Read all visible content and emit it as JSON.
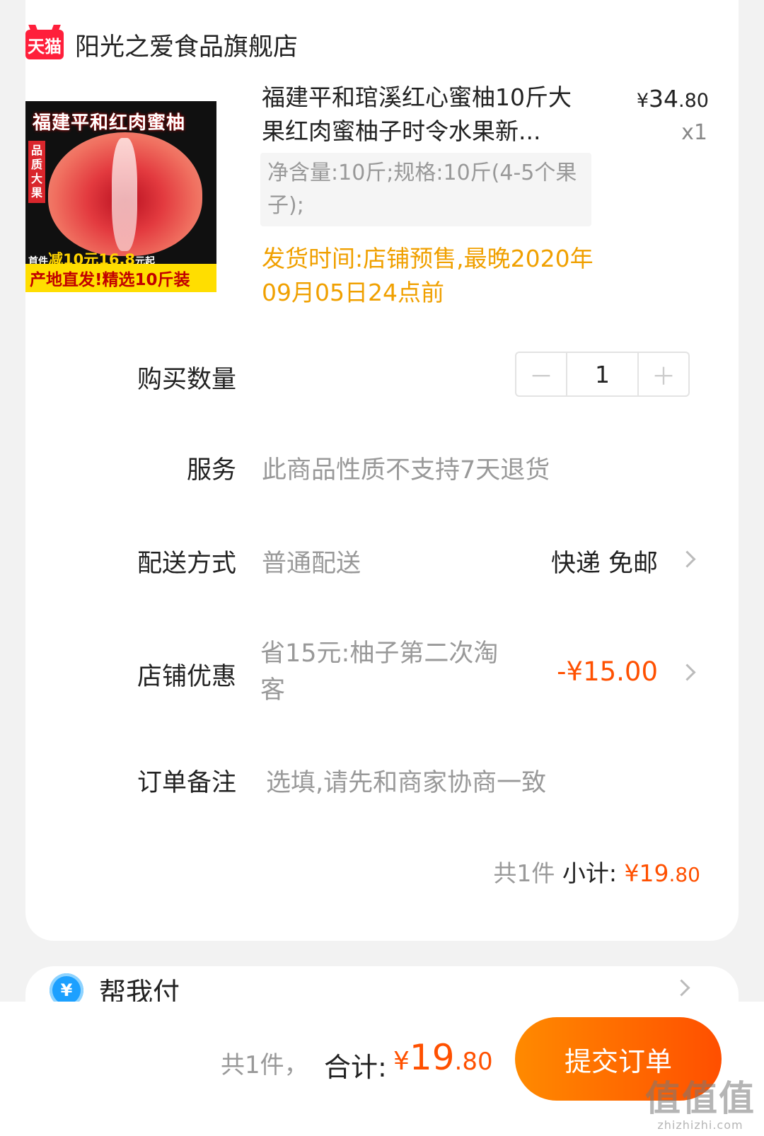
{
  "store": {
    "badge": "天猫",
    "name": "阳光之爱食品旗舰店"
  },
  "product": {
    "image": {
      "title": "福建平和红肉蜜柚",
      "side": "品质大果",
      "promo_prefix": "首件",
      "promo": "减10元16.8",
      "promo_suffix": "元起",
      "banner": "产地直发!精选10斤装"
    },
    "title": "福建平和琯溪红心蜜柚10斤大果红肉蜜柚子时令水果新...",
    "price_currency": "¥",
    "price_int": "34",
    "price_dec": ".80",
    "qty": "x1",
    "spec": "净含量:10斤;规格:10斤(4-5个果子);",
    "ship_time": "发货时间:店铺预售,最晚2020年09月05日24点前"
  },
  "quantity": {
    "label": "购买数量",
    "minus": "－",
    "value": "1",
    "plus": "＋"
  },
  "service": {
    "label": "服务",
    "value": "此商品性质不支持7天退货"
  },
  "shipping": {
    "label": "配送方式",
    "value": "普通配送",
    "detail": "快递 免邮"
  },
  "discount": {
    "label": "店铺优惠",
    "desc": "省15元:柚子第二次淘客",
    "amount": "-¥15.00"
  },
  "note": {
    "label": "订单备注",
    "placeholder": "选填,请先和商家协商一致"
  },
  "subtotal": {
    "count": "共1件",
    "label": "小计:",
    "currency": "¥",
    "int": "19",
    "dec": ".80"
  },
  "pay_for_me": {
    "icon": "¥",
    "label": "帮我付"
  },
  "footer": {
    "count": "共1件，",
    "total_label": "合计:",
    "currency": "¥",
    "total_int": "19",
    "total_dec": ".80",
    "submit": "提交订单"
  },
  "watermark": {
    "main": "值值值",
    "sub": "zhizhizhi.com"
  },
  "colors": {
    "accent": "#ff5000",
    "ship_time": "#f0a000",
    "tmall": "#ff1f3b"
  }
}
